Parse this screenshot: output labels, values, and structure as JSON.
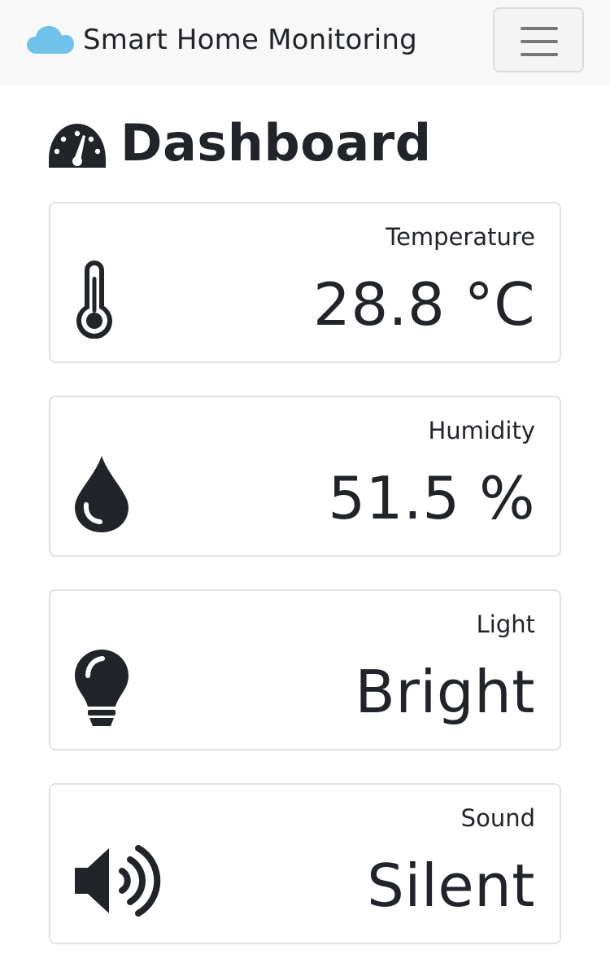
{
  "navbar": {
    "brand_text": "Smart Home Monitoring",
    "brand_icon": "cloud-icon",
    "brand_icon_color": "#6fc3ea",
    "menu_icon": "hamburger-menu-icon"
  },
  "header": {
    "title": "Dashboard",
    "icon": "tachometer-icon"
  },
  "sensors": [
    {
      "label": "Temperature",
      "value": "28.8 °C",
      "icon": "thermometer-icon"
    },
    {
      "label": "Humidity",
      "value": "51.5 %",
      "icon": "water-drop-icon"
    },
    {
      "label": "Light",
      "value": "Bright",
      "icon": "lightbulb-icon"
    },
    {
      "label": "Sound",
      "value": "Silent",
      "icon": "volume-up-icon"
    }
  ],
  "colors": {
    "text": "#212529",
    "navbar_bg": "#f8f8f8",
    "card_border": "#dee2e6",
    "accent": "#6fc3ea"
  }
}
